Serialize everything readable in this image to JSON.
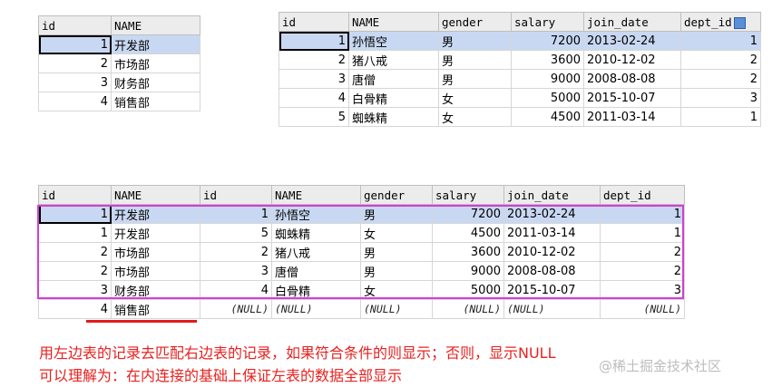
{
  "dept_table": {
    "headers": [
      "id",
      "NAME"
    ],
    "rows": [
      [
        "1",
        "开发部"
      ],
      [
        "2",
        "市场部"
      ],
      [
        "3",
        "财务部"
      ],
      [
        "4",
        "销售部"
      ]
    ]
  },
  "emp_table": {
    "headers": [
      "id",
      "NAME",
      "gender",
      "salary",
      "join_date",
      "dept_id"
    ],
    "rows": [
      [
        "1",
        "孙悟空",
        "男",
        "7200",
        "2013-02-24",
        "1"
      ],
      [
        "2",
        "猪八戒",
        "男",
        "3600",
        "2010-12-02",
        "2"
      ],
      [
        "3",
        "唐僧",
        "男",
        "9000",
        "2008-08-08",
        "2"
      ],
      [
        "4",
        "白骨精",
        "女",
        "5000",
        "2015-10-07",
        "3"
      ],
      [
        "5",
        "蜘蛛精",
        "女",
        "4500",
        "2011-03-14",
        "1"
      ]
    ]
  },
  "join_table": {
    "headers": [
      "id",
      "NAME",
      "id",
      "NAME",
      "gender",
      "salary",
      "join_date",
      "dept_id"
    ],
    "rows": [
      [
        "1",
        "开发部",
        "1",
        "孙悟空",
        "男",
        "7200",
        "2013-02-24",
        "1"
      ],
      [
        "1",
        "开发部",
        "5",
        "蜘蛛精",
        "女",
        "4500",
        "2011-03-14",
        "1"
      ],
      [
        "2",
        "市场部",
        "2",
        "猪八戒",
        "男",
        "3600",
        "2010-12-02",
        "2"
      ],
      [
        "2",
        "市场部",
        "3",
        "唐僧",
        "男",
        "9000",
        "2008-08-08",
        "2"
      ],
      [
        "3",
        "财务部",
        "4",
        "白骨精",
        "女",
        "5000",
        "2015-10-07",
        "3"
      ],
      [
        "4",
        "销售部",
        "(NULL)",
        "(NULL)",
        "(NULL)",
        "(NULL)",
        "(NULL)",
        "(NULL)"
      ]
    ]
  },
  "notes": {
    "line1": "用左边表的记录去匹配右边表的记录，如果符合条件的则显示；否则，显示NULL",
    "line2": "可以理解为：在内连接的基础上保证左表的数据全部显示"
  },
  "watermark": "@稀土掘金技术社区",
  "colors": {
    "selection": "#c9d8f2",
    "highlight_box": "#d33fd3",
    "note_text": "#e8211f"
  }
}
